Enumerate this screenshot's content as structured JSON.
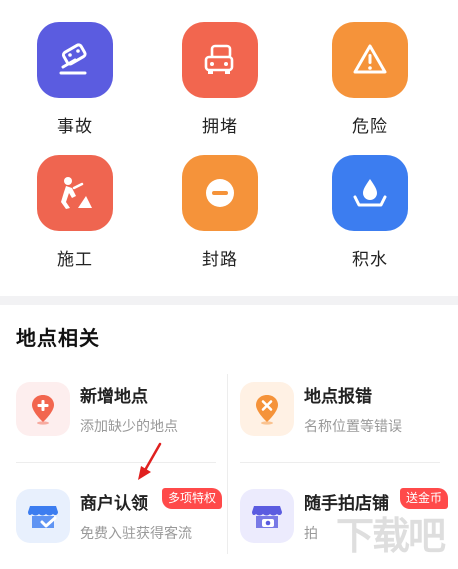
{
  "report_types": [
    {
      "label": "事故",
      "icon": "car-accident-icon",
      "color": "#5b5ce0"
    },
    {
      "label": "拥堵",
      "icon": "traffic-jam-icon",
      "color": "#f2664f"
    },
    {
      "label": "危险",
      "icon": "warning-icon",
      "color": "#f5933a"
    },
    {
      "label": "施工",
      "icon": "construction-icon",
      "color": "#ef6550"
    },
    {
      "label": "封路",
      "icon": "road-closed-icon",
      "color": "#f5933a"
    },
    {
      "label": "积水",
      "icon": "water-icon",
      "color": "#3c7df0"
    }
  ],
  "location_section": {
    "title": "地点相关",
    "items": [
      {
        "title": "新增地点",
        "subtitle": "添加缺少的地点",
        "icon": "add-location-icon"
      },
      {
        "title": "地点报错",
        "subtitle": "名称位置等错误",
        "icon": "location-error-icon"
      },
      {
        "title": "商户认领",
        "subtitle": "免费入驻获得客流",
        "icon": "shop-claim-icon",
        "badge": "多项特权"
      },
      {
        "title": "随手拍店铺",
        "subtitle": "拍",
        "icon": "shop-photo-icon",
        "badge": "送金币"
      }
    ]
  },
  "watermark": "下载吧"
}
